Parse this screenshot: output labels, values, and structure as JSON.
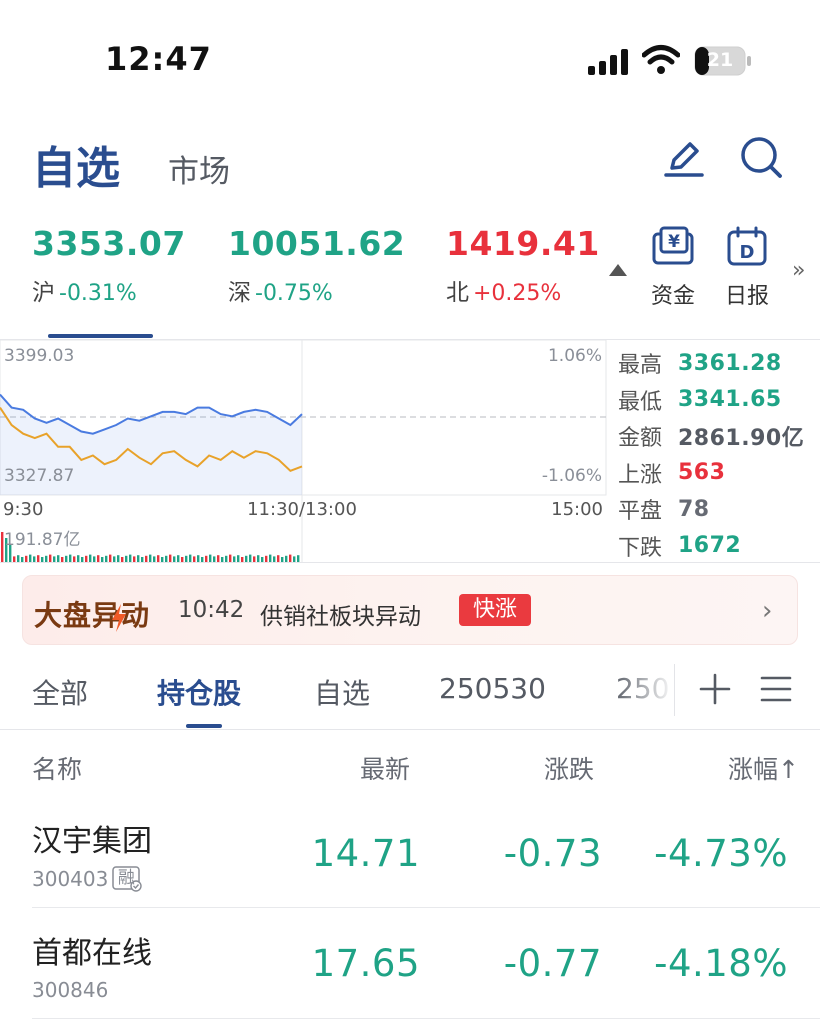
{
  "status_bar": {
    "time": "12:47",
    "battery_level": "21"
  },
  "header": {
    "tabs": [
      {
        "label": "自选",
        "active": true
      },
      {
        "label": "市场",
        "active": false
      }
    ]
  },
  "indices": [
    {
      "value": "3353.07",
      "name": "沪",
      "change": "-0.31%",
      "color": "#1fa386"
    },
    {
      "value": "10051.62",
      "name": "深",
      "change": "-0.75%",
      "color": "#1fa386"
    },
    {
      "value": "1419.41",
      "name": "北",
      "change": "+0.25%",
      "color": "#e8313c"
    }
  ],
  "tools": [
    {
      "label": "资金",
      "icon": "yen-card-icon"
    },
    {
      "label": "日报",
      "icon": "calendar-d-icon"
    }
  ],
  "chart_data": {
    "type": "line",
    "y_labels": {
      "top": "3399.03",
      "bottom": "3327.87",
      "right_top": "1.06%",
      "right_bottom": "-1.06%"
    },
    "x_labels": [
      "9:30",
      "11:30/13:00",
      "15:00"
    ],
    "volume_label": "191.87亿",
    "ylim": [
      3327.87,
      3399.03
    ],
    "series": [
      {
        "color": "#4a7be0",
        "values": [
          3374,
          3368,
          3367,
          3363,
          3361,
          3363,
          3360,
          3357,
          3356,
          3358,
          3360,
          3363,
          3362,
          3364,
          3366,
          3366,
          3365,
          3368,
          3368,
          3365,
          3364,
          3366,
          3367,
          3366,
          3363,
          3360,
          3365
        ]
      },
      {
        "color": "#e8a22a",
        "values": [
          3368,
          3360,
          3356,
          3354,
          3356,
          3350,
          3350,
          3344,
          3346,
          3342,
          3344,
          3349,
          3345,
          3342,
          3347,
          3348,
          3344,
          3341,
          3346,
          3344,
          3348,
          3345,
          3348,
          3347,
          3344,
          3339,
          3341
        ]
      }
    ]
  },
  "stats": [
    {
      "label": "最高",
      "value": "3361.28",
      "color": "#1fa386"
    },
    {
      "label": "最低",
      "value": "3341.65",
      "color": "#1fa386"
    },
    {
      "label": "金额",
      "value": "2861.90亿",
      "color": "#555a63"
    },
    {
      "label": "上涨",
      "value": "563",
      "color": "#e8313c"
    },
    {
      "label": "平盘",
      "value": "78",
      "color": "#666a73"
    },
    {
      "label": "下跌",
      "value": "1672",
      "color": "#1fa386"
    }
  ],
  "alert": {
    "title": "大盘异动",
    "time": "10:42",
    "text": "供销社板块异动",
    "tag": "快涨"
  },
  "list_tabs": [
    {
      "label": "全部",
      "active": false
    },
    {
      "label": "持仓股",
      "active": true
    },
    {
      "label": "自选",
      "active": false
    },
    {
      "label": "250530",
      "active": false
    },
    {
      "label": "250",
      "active": false
    }
  ],
  "table": {
    "headers": {
      "name": "名称",
      "latest": "最新",
      "change": "涨跌",
      "pct": "涨幅↑"
    },
    "rows": [
      {
        "name": "汉宇集团",
        "code": "300403",
        "badge": "融",
        "latest": "14.71",
        "change": "-0.73",
        "pct": "-4.73%"
      },
      {
        "name": "首都在线",
        "code": "300846",
        "badge": "",
        "latest": "17.65",
        "change": "-0.77",
        "pct": "-4.18%"
      }
    ]
  }
}
